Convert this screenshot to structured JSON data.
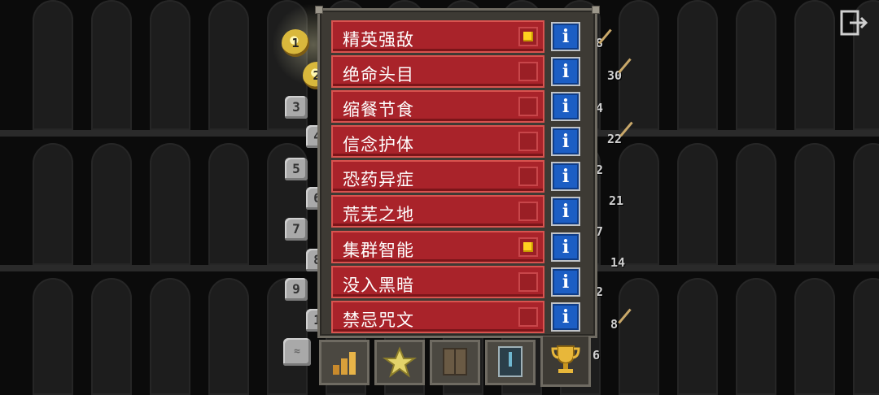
{
  "challenges": [
    {
      "label": "精英强敌",
      "checked": true
    },
    {
      "label": "绝命头目",
      "checked": false
    },
    {
      "label": "缩餐节食",
      "checked": false
    },
    {
      "label": "信念护体",
      "checked": false
    },
    {
      "label": "恐药异症",
      "checked": false
    },
    {
      "label": "荒芜之地",
      "checked": false
    },
    {
      "label": "集群智能",
      "checked": true
    },
    {
      "label": "没入黑暗",
      "checked": false
    },
    {
      "label": "禁忌咒文",
      "checked": false
    }
  ],
  "info_glyph": "i",
  "level_markers": [
    "1",
    "2",
    "3",
    "4",
    "5",
    "6",
    "7",
    "8",
    "9",
    "1"
  ],
  "side_numbers": [
    "8",
    "30",
    "4",
    "22",
    "2",
    "21",
    "7",
    "14",
    "2",
    "8",
    "6"
  ],
  "tabs": [
    {
      "name": "stats-tab",
      "icon": "bar-chart-icon"
    },
    {
      "name": "badges-tab",
      "icon": "star-icon"
    },
    {
      "name": "journal-tab",
      "icon": "book-icon"
    },
    {
      "name": "catalog-tab",
      "icon": "scroll-icon"
    },
    {
      "name": "challenges-tab",
      "icon": "trophy-icon",
      "active": true
    }
  ],
  "colors": {
    "row_red": "#a9232a",
    "info_blue": "#1c5ec4",
    "checkbox_on": "#ffd21f",
    "panel": "#3d3a34"
  }
}
